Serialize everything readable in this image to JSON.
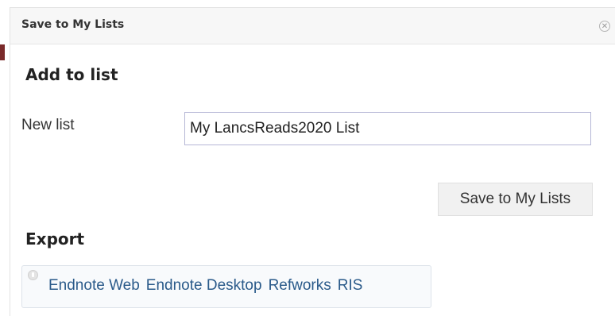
{
  "dialog": {
    "title": "Save to My Lists",
    "close_icon": "close-icon"
  },
  "add_to_list": {
    "heading": "Add to list",
    "new_list_label": "New list",
    "new_list_value": "My LancsReads2020 List",
    "save_button": "Save to My Lists"
  },
  "export": {
    "heading": "Export",
    "icon": "pushpin-icon",
    "links": [
      "Endnote Web",
      "Endnote Desktop",
      "Refworks",
      "RIS"
    ]
  }
}
